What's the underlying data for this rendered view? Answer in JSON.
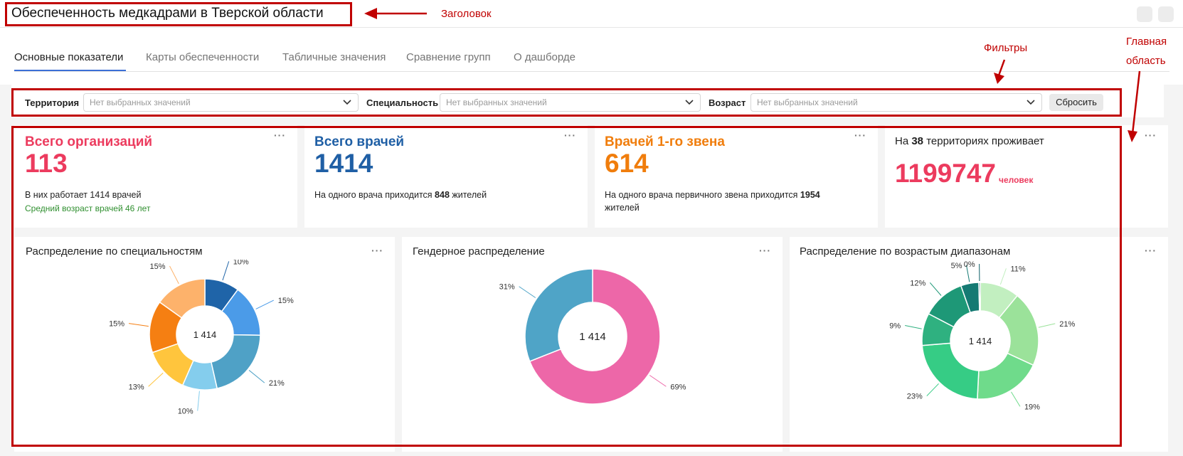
{
  "header": {
    "title": "Обеспеченность медкадрами в Тверской области"
  },
  "tabs": [
    {
      "label": "Основные показатели",
      "active": true
    },
    {
      "label": "Карты обеспеченности",
      "active": false
    },
    {
      "label": "Табличные значения",
      "active": false
    },
    {
      "label": "Сравнение групп",
      "active": false
    },
    {
      "label": "О дашборде",
      "active": false
    }
  ],
  "filters": {
    "territory_label": "Территория",
    "specialty_label": "Специальность",
    "age_label": "Возраст",
    "placeholder": "Нет выбранных значений",
    "reset_label": "Сбросить"
  },
  "kpis": {
    "orgs": {
      "title": "Всего организаций",
      "value": "113",
      "note": "В них работает 1414 врачей",
      "note2": "Средний возраст врачей 46 лет",
      "color": "#ec3b5e"
    },
    "doctors": {
      "title": "Всего врачей",
      "value": "1414",
      "note_pre": "На одного врача приходится ",
      "note_bold": "848",
      "note_post": " жителей",
      "color": "#1f5fa5"
    },
    "primary": {
      "title": "Врачей 1-го звена",
      "value": "614",
      "note_pre": "На одного врача первичного звена приходится ",
      "note_bold": "1954",
      "note_post": "жителей",
      "color": "#f07d0c"
    },
    "population": {
      "pre": "На ",
      "bold": "38",
      "post": " территориях проживает",
      "value": "1199747",
      "unit": "человек",
      "color": "#ec3b5e"
    }
  },
  "menu_dots": "···",
  "annotations": {
    "header": "Заголовок",
    "filters": "Фильтры",
    "main_line1": "Главная",
    "main_line2": "область",
    "color": "#c00000"
  },
  "chart_data": [
    {
      "type": "pie",
      "title": "Распределение по специальностям",
      "center_label": "1 414",
      "values": [
        10,
        15,
        21,
        10,
        13,
        15,
        15
      ],
      "labels": [
        "10%",
        "15%",
        "21%",
        "10%",
        "13%",
        "15%",
        "15%"
      ],
      "colors": [
        "#1f64a8",
        "#4b9be8",
        "#4fa1c6",
        "#84cded",
        "#ffc53d",
        "#f57f12",
        "#fdb26b"
      ]
    },
    {
      "type": "pie",
      "title": "Гендерное распределение",
      "center_label": "1 414",
      "values": [
        69,
        31
      ],
      "labels": [
        "69%",
        "31%"
      ],
      "colors": [
        "#ed67a8",
        "#4fa4c7"
      ]
    },
    {
      "type": "pie",
      "title": "Распределение по возрастым диапазонам",
      "center_label": "1 414",
      "values": [
        11,
        21,
        19,
        23,
        9,
        12,
        5,
        0.4
      ],
      "labels": [
        "11%",
        "21%",
        "19%",
        "23%",
        "9%",
        "12%",
        "5%",
        "0%"
      ],
      "colors": [
        "#c2efc0",
        "#9be29a",
        "#6fdb8b",
        "#36cc85",
        "#2fb180",
        "#1e9877",
        "#157a73",
        "#0c5e66"
      ]
    }
  ]
}
